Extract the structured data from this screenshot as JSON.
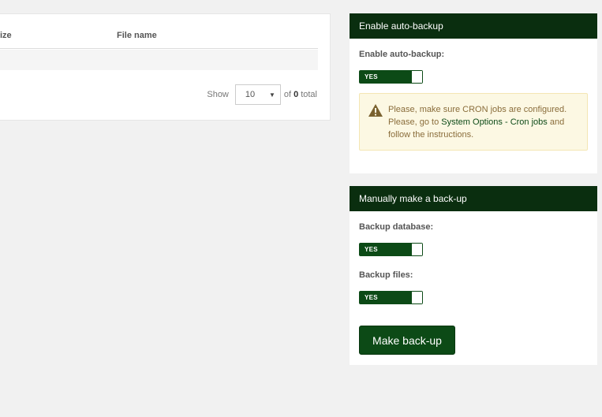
{
  "table": {
    "columns": [
      "ize",
      "File name"
    ]
  },
  "pager": {
    "show_label": "Show",
    "page_size": "10",
    "of_label": "of",
    "total": "0",
    "total_label": "total"
  },
  "auto_backup": {
    "header": "Enable auto-backup",
    "field_label": "Enable auto-backup:",
    "toggle_label": "YES",
    "warning": {
      "line1": "Please, make sure CRON jobs are configured.",
      "line2_prefix": "Please, go to",
      "link_text": "System Options - Cron jobs",
      "line2_suffix": "and",
      "line3": "follow the instructions."
    }
  },
  "manual_backup": {
    "header": "Manually make a back-up",
    "database_label": "Backup database:",
    "database_toggle": "YES",
    "files_label": "Backup files:",
    "files_toggle": "YES",
    "button_label": "Make back-up"
  },
  "colors": {
    "header_bg": "#0a2e0f",
    "accent": "#0c4a16",
    "warning_bg": "#fcf8e3",
    "warning_text": "#8a6d3b",
    "warning_icon": "#7a6230"
  }
}
